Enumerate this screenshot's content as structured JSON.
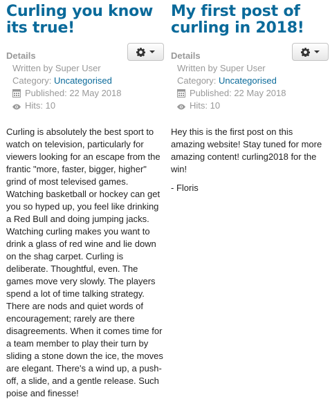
{
  "articles": [
    {
      "title": "Curling you know its true!",
      "details_label": "Details",
      "written_by": "Written by Super User",
      "category_prefix": "Category: ",
      "category": "Uncategorised",
      "published": "Published: 22 May 2018",
      "hits": "Hits: 10",
      "paragraphs": [
        "Curling is absolutely the best sport to watch on television, particularly for viewers looking for an escape from the frantic \"more, faster, bigger, higher\" grind of most televised games. Watching basketball or hockey can get you so hyped up, you feel like drinking a Red Bull and doing jumping jacks. Watching curling makes you want to drink a glass of red wine and lie down on the shag carpet. Curling is deliberate. Thoughtful, even. The games move very slowly. The players spend a lot of time talking strategy. There are nods and quiet words of encouragement; rarely are there disagreements. When it comes time for a team member to play their turn by sliding a stone down the ice, the moves are elegant. There's a wind up, a push-off, a slide, and a gentle release. Such poise and finesse!"
      ]
    },
    {
      "title": "My first post of curling in 2018!",
      "details_label": "Details",
      "written_by": "Written by Super User",
      "category_prefix": "Category: ",
      "category": "Uncategorised",
      "published": "Published: 22 May 2018",
      "hits": "Hits: 10",
      "paragraphs": [
        "Hey this is the first post on this amazing website! Stay tuned for more amazing content! curling2018 for the win!",
        "- Floris"
      ]
    }
  ],
  "icons": {
    "tools": "gear-icon",
    "caret": "caret-down-icon",
    "published": "calendar-icon",
    "hits": "eye-icon"
  },
  "colors": {
    "title": "#0a6a9a",
    "link": "#0a6a9a",
    "meta": "#999999",
    "body": "#222222"
  }
}
